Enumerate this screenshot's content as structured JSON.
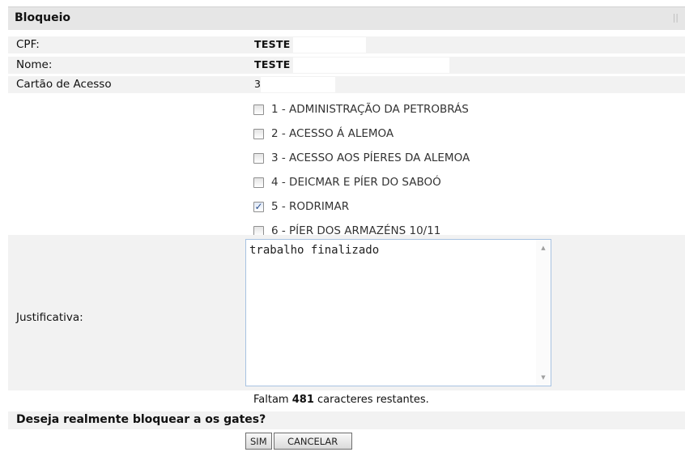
{
  "panel": {
    "title": "Bloqueio"
  },
  "info": {
    "cpf_label": "CPF:",
    "cpf_value": "TESTE",
    "nome_label": "Nome:",
    "nome_value": "TESTE",
    "cartao_label": "Cartão de Acesso",
    "cartao_value": "3"
  },
  "gates": [
    {
      "label": "1 - ADMINISTRAÇÃO DA PETROBRÁS",
      "checked": false
    },
    {
      "label": "2 - ACESSO Á ALEMOA",
      "checked": false
    },
    {
      "label": "3 - ACESSO AOS PÍERES DA ALEMOA",
      "checked": false
    },
    {
      "label": "4 - DEICMAR E PÍER DO SABOÓ",
      "checked": false
    },
    {
      "label": "5 - RODRIMAR",
      "checked": true
    },
    {
      "label": "6 - PÍER DOS ARMAZÉNS 10/11",
      "checked": false
    }
  ],
  "justificativa": {
    "label": "Justificativa:",
    "value": "trabalho finalizado"
  },
  "remaining": {
    "prefix": "Faltam",
    "count": "481",
    "suffix": "caracteres restantes."
  },
  "confirm": {
    "question": "Deseja realmente bloquear a os gates?"
  },
  "buttons": {
    "yes": "SIM",
    "cancel": "CANCELAR"
  }
}
